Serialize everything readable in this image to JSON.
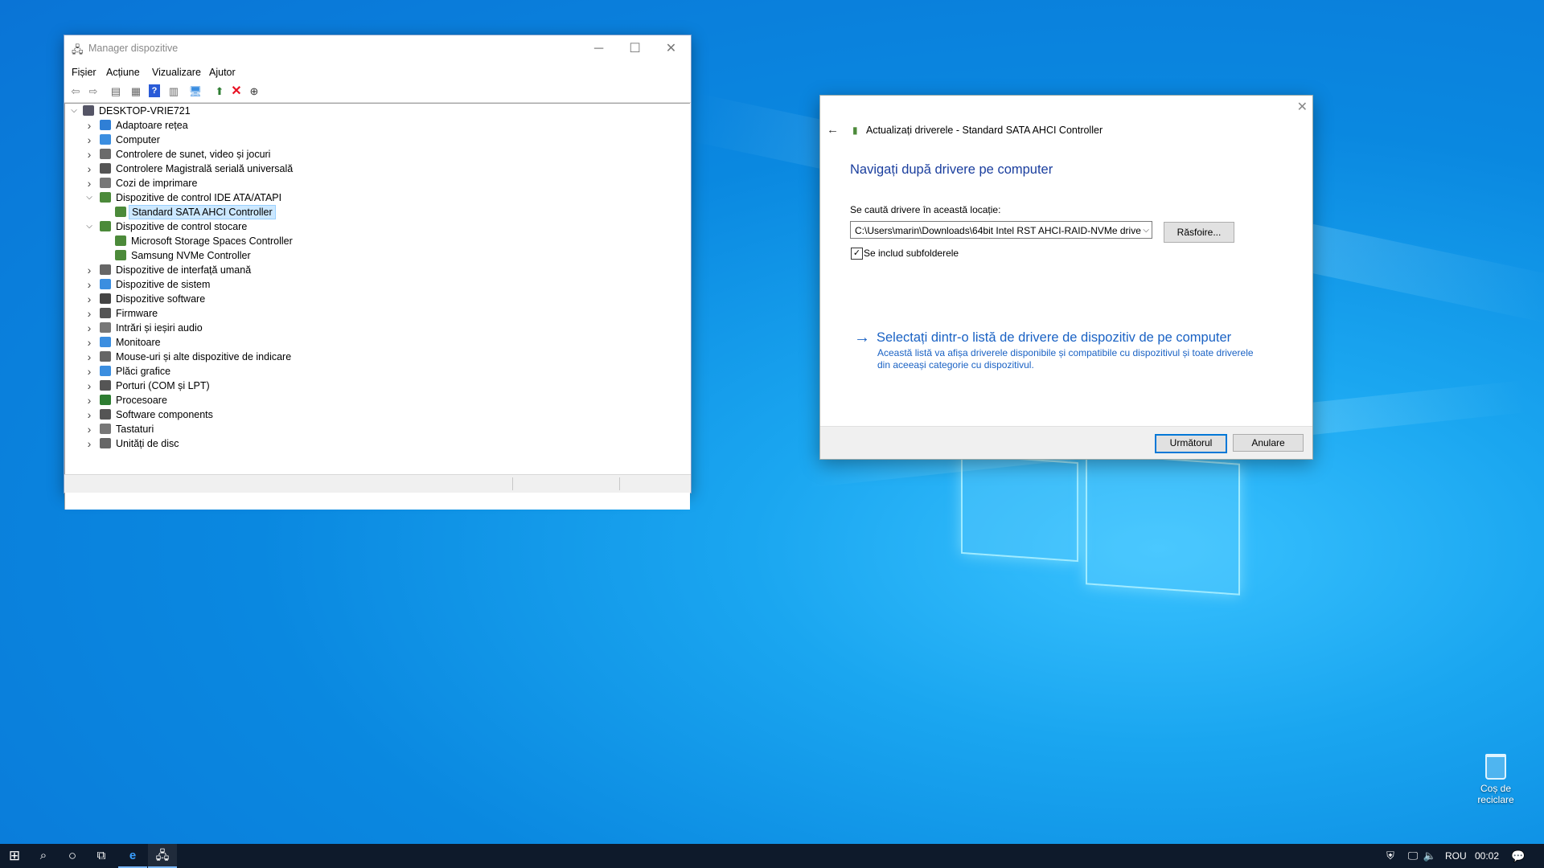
{
  "device_manager": {
    "title": "Manager dispozitive",
    "menu": [
      "Fișier",
      "Acțiune",
      "Vizualizare",
      "Ajutor"
    ],
    "root": "DESKTOP-VRIE721",
    "tree": [
      {
        "label": "Adaptoare rețea",
        "level": 1,
        "state": "collapsed",
        "icon": "network-adapter-icon",
        "color": "#2f7fd6"
      },
      {
        "label": "Computer",
        "level": 1,
        "state": "collapsed",
        "icon": "computer-icon",
        "color": "#3b8ee0"
      },
      {
        "label": "Controlere de sunet, video și jocuri",
        "level": 1,
        "state": "collapsed",
        "icon": "speaker-icon",
        "color": "#6b6b6b"
      },
      {
        "label": "Controlere Magistrală serială universală",
        "level": 1,
        "state": "collapsed",
        "icon": "usb-icon",
        "color": "#555"
      },
      {
        "label": "Cozi de imprimare",
        "level": 1,
        "state": "collapsed",
        "icon": "printer-icon",
        "color": "#777"
      },
      {
        "label": "Dispozitive de control IDE ATA/ATAPI",
        "level": 1,
        "state": "expanded",
        "icon": "ide-controller-icon",
        "color": "#4c8a3a"
      },
      {
        "label": "Standard SATA AHCI Controller",
        "level": 2,
        "state": "leaf",
        "icon": "sata-controller-icon",
        "color": "#4c8a3a",
        "selected": true
      },
      {
        "label": "Dispozitive de control stocare",
        "level": 1,
        "state": "expanded",
        "icon": "storage-controller-icon",
        "color": "#4c8a3a"
      },
      {
        "label": "Microsoft Storage Spaces Controller",
        "level": 2,
        "state": "leaf",
        "icon": "storage-controller-icon",
        "color": "#4c8a3a"
      },
      {
        "label": "Samsung NVMe Controller",
        "level": 2,
        "state": "leaf",
        "icon": "storage-controller-icon",
        "color": "#4c8a3a"
      },
      {
        "label": "Dispozitive de interfață umană",
        "level": 1,
        "state": "collapsed",
        "icon": "hid-icon",
        "color": "#666"
      },
      {
        "label": "Dispozitive de sistem",
        "level": 1,
        "state": "collapsed",
        "icon": "system-device-icon",
        "color": "#3b8ee0"
      },
      {
        "label": "Dispozitive software",
        "level": 1,
        "state": "collapsed",
        "icon": "software-device-icon",
        "color": "#444"
      },
      {
        "label": "Firmware",
        "level": 1,
        "state": "collapsed",
        "icon": "firmware-icon",
        "color": "#555"
      },
      {
        "label": "Intrări și ieșiri audio",
        "level": 1,
        "state": "collapsed",
        "icon": "audio-io-icon",
        "color": "#777"
      },
      {
        "label": "Monitoare",
        "level": 1,
        "state": "collapsed",
        "icon": "monitor-icon",
        "color": "#3b8ee0"
      },
      {
        "label": "Mouse-uri și alte dispozitive de indicare",
        "level": 1,
        "state": "collapsed",
        "icon": "mouse-icon",
        "color": "#666"
      },
      {
        "label": "Plăci grafice",
        "level": 1,
        "state": "collapsed",
        "icon": "display-adapter-icon",
        "color": "#3b8ee0"
      },
      {
        "label": "Porturi (COM și LPT)",
        "level": 1,
        "state": "collapsed",
        "icon": "port-icon",
        "color": "#555"
      },
      {
        "label": "Procesoare",
        "level": 1,
        "state": "collapsed",
        "icon": "processor-icon",
        "color": "#2e7d32"
      },
      {
        "label": "Software components",
        "level": 1,
        "state": "collapsed",
        "icon": "software-component-icon",
        "color": "#555"
      },
      {
        "label": "Tastaturi",
        "level": 1,
        "state": "collapsed",
        "icon": "keyboard-icon",
        "color": "#777"
      },
      {
        "label": "Unități de disc",
        "level": 1,
        "state": "collapsed",
        "icon": "disk-drive-icon",
        "color": "#666"
      }
    ]
  },
  "update_dialog": {
    "title": "Actualizați driverele - Standard SATA AHCI Controller",
    "heading": "Navigați după drivere pe computer",
    "search_label": "Se caută drivere în această locație:",
    "path_value": "C:\\Users\\marin\\Downloads\\64bit Intel RST AHCI-RAID-NVMe drive",
    "browse_label": "Răsfoire...",
    "include_subfolders_label": "Se includ subfolderele",
    "include_subfolders_checked": true,
    "link_title": "Selectați dintr-o listă de drivere de dispozitiv de pe computer",
    "link_description": "Această listă va afișa driverele disponibile și compatibile cu dispozitivul și toate driverele din aceeași categorie cu dispozitivul.",
    "next_label": "Următorul",
    "cancel_label": "Anulare"
  },
  "desktop": {
    "recycle_bin_label": "Coș de reciclare"
  },
  "taskbar": {
    "language": "ROU",
    "time": "00:02"
  },
  "colors": {
    "accent": "#0078d7",
    "taskbar": "#0e1a2b",
    "heading_blue": "#1a3e9e",
    "link_blue": "#1a62c4",
    "selection": "#cce8ff",
    "delete_red": "#e81123"
  }
}
